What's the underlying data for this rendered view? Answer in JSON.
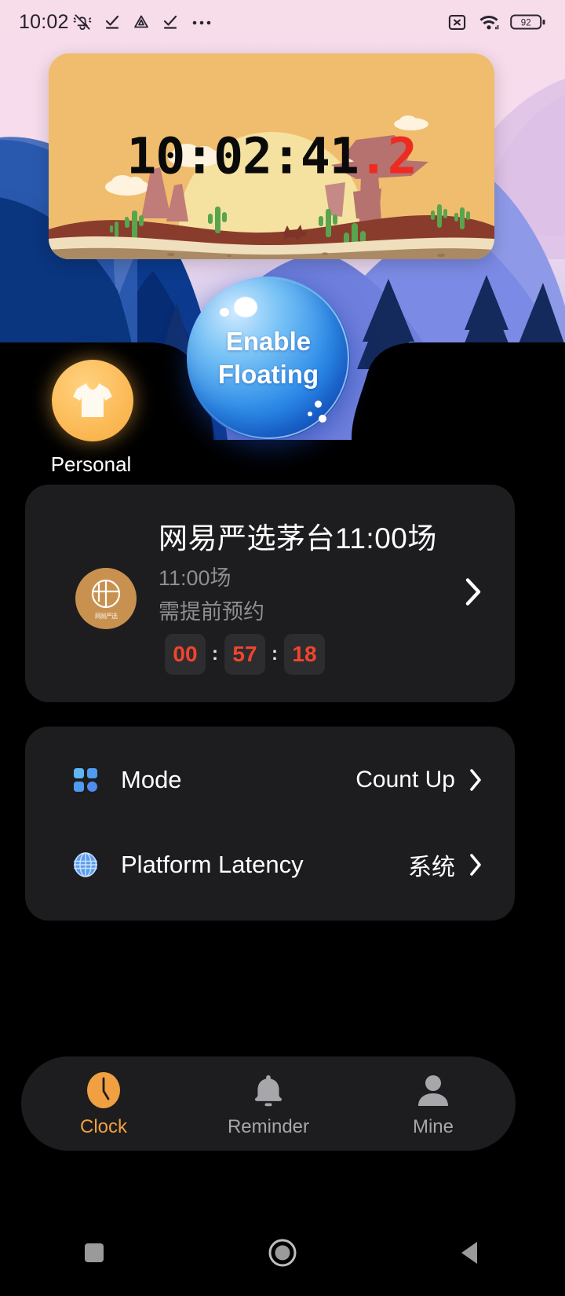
{
  "statusbar": {
    "time": "10:02",
    "left_icons": [
      "bell-muted-icon",
      "check-underline-icon",
      "triangle-alert-icon",
      "check-underline-icon",
      "more-dots-icon"
    ],
    "right_icons": [
      "sim-disabled-icon",
      "wifi-icon",
      "battery-icon"
    ],
    "battery_level": "92"
  },
  "banner": {
    "clock_main": "10:02:41",
    "clock_ms": ".2",
    "scene": "desert-sunset-illustration"
  },
  "floating_button": {
    "line1": "Enable",
    "line2": "Floating"
  },
  "personal": {
    "label": "Personal",
    "icon": "tshirt-icon"
  },
  "event_card": {
    "title": "网易严选茅台11:00场",
    "subtitle1": "11:00场",
    "subtitle2": "需提前预约",
    "avatar_brand": "网易严选",
    "countdown": {
      "hours": "00",
      "minutes": "57",
      "seconds": "18",
      "separator": ":"
    },
    "chevron": "chevron-right-icon",
    "accent_color": "#f0452c"
  },
  "settings": {
    "rows": [
      {
        "icon": "grid-squares-icon",
        "label": "Mode",
        "value": "Count Up",
        "chevron": "chevron-right-icon"
      },
      {
        "icon": "globe-icon",
        "label": "Platform Latency",
        "value": "系统",
        "chevron": "chevron-right-icon"
      }
    ]
  },
  "tabbar": {
    "tabs": [
      {
        "label": "Clock",
        "icon": "clock-icon",
        "active": true
      },
      {
        "label": "Reminder",
        "icon": "bell-icon",
        "active": false
      },
      {
        "label": "Mine",
        "icon": "person-icon",
        "active": false
      }
    ],
    "active_color": "#f0a040",
    "inactive_color": "#a6a6ab"
  },
  "android_nav": {
    "buttons": [
      "recents-square-icon",
      "home-circle-icon",
      "back-triangle-icon"
    ]
  }
}
